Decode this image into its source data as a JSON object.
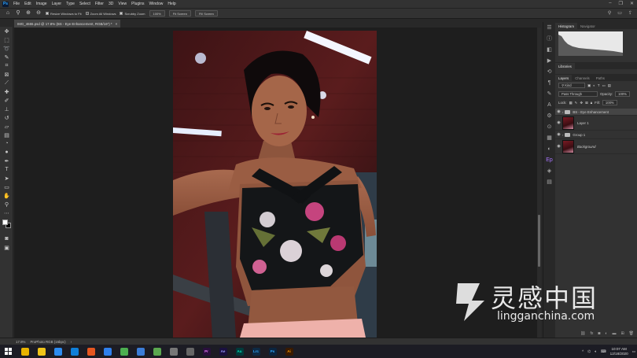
{
  "app": {
    "name": "Adobe Photoshop",
    "logo_text": "Ps"
  },
  "menu": [
    "File",
    "Edit",
    "Image",
    "Layer",
    "Type",
    "Select",
    "Filter",
    "3D",
    "View",
    "Plugins",
    "Window",
    "Help"
  ],
  "options": {
    "resize_windows": "Resize Windows to Fit",
    "zoom_all": "Zoom All Windows",
    "scrubby_zoom": "Scrubby Zoom",
    "zoom_value": "100%",
    "fit_screen": "Fit Screen",
    "fill_screen": "Fill Screen"
  },
  "document_tab": {
    "title": "IMG_4655.psd @ 17.8% (BS - Eye Enhancement, RGB/16*) *",
    "close": "×"
  },
  "panels": {
    "histogram_tabs": [
      "Histogram",
      "Navigator"
    ],
    "libraries_label": "Libraries",
    "layer_tabs": [
      "Layers",
      "Channels",
      "Paths"
    ],
    "kind_label": "Kind",
    "blend_mode": "Pass Through",
    "opacity_label": "Opacity:",
    "opacity_value": "100%",
    "lock_label": "Lock:",
    "fill_label": "Fill:",
    "fill_value": "100%"
  },
  "layers": [
    {
      "name": "BS - Eye Enhancement",
      "type": "group",
      "selected": true
    },
    {
      "name": "Layer 1",
      "type": "image",
      "selected": false
    },
    {
      "name": "Group 1",
      "type": "group",
      "selected": false
    },
    {
      "name": "Background",
      "type": "image",
      "selected": false
    }
  ],
  "status": {
    "zoom": "17.8%",
    "doc_info": "ProPhoto RGB (16bpc)"
  },
  "taskbar": {
    "apps": [
      {
        "label": "",
        "color": "#e8b300"
      },
      {
        "label": "",
        "color": "#f0c419"
      },
      {
        "label": "",
        "color": "#2d8cf0"
      },
      {
        "label": "",
        "color": "#0f7fd9"
      },
      {
        "label": "",
        "color": "#e5561f"
      },
      {
        "label": "",
        "color": "#2f80ed"
      },
      {
        "label": "",
        "color": "#4caf50"
      },
      {
        "label": "",
        "color": "#3b7dd8"
      },
      {
        "label": "",
        "color": "#5ba84f"
      },
      {
        "label": "",
        "color": "#777777"
      },
      {
        "label": "",
        "color": "#666666"
      },
      {
        "label": "Pr",
        "color": "#2a0f3d"
      },
      {
        "label": "Ae",
        "color": "#1a1040"
      },
      {
        "label": "Au",
        "color": "#003b3b"
      },
      {
        "label": "Lrc",
        "color": "#0d2a45"
      },
      {
        "label": "Ps",
        "color": "#0a2540"
      },
      {
        "label": "Ai",
        "color": "#3a1a00"
      }
    ],
    "time": "10:07 AM",
    "date": "12/18/2020"
  },
  "watermark": {
    "cn": "灵感中国",
    "domain": "lingganchina.com"
  },
  "colors": {
    "accent": "#31a8ff",
    "panel_bg": "#323232",
    "canvas_bg": "#1e1e1e"
  }
}
